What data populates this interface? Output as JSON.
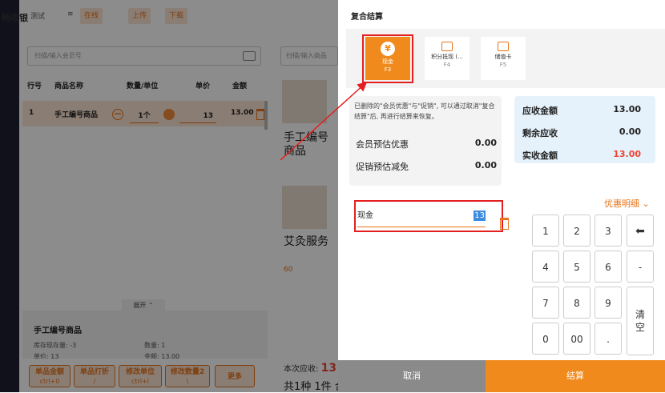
{
  "topbar": {
    "brand": "畅收银",
    "store": "测试",
    "status": "在线",
    "upload": "上传",
    "download": "下载"
  },
  "member_search": {
    "placeholder": "扫描/输入会员号"
  },
  "table": {
    "headers": [
      "行号",
      "商品名称",
      "数量/单位",
      "单价",
      "金额"
    ],
    "row": {
      "index": "1",
      "name": "手工编号商品",
      "qty": "1个",
      "price": "13",
      "amount": "13.00"
    }
  },
  "panel": {
    "expand": "展开",
    "title": "手工编号商品",
    "stock_label": "库存现存量: -3",
    "qty_label": "数量: 1",
    "price_label": "单价: 13",
    "amount_label": "金额: 13.00"
  },
  "buttons": [
    {
      "label": "单品金额",
      "shortcut": "ctrl+0"
    },
    {
      "label": "单品打折",
      "shortcut": "/"
    },
    {
      "label": "修改单位",
      "shortcut": "ctrl+l"
    },
    {
      "label": "修改数量2",
      "shortcut": "\\"
    },
    {
      "label": "更多",
      "shortcut": ""
    }
  ],
  "products": {
    "search_placeholder": "扫描/输入商品",
    "items": [
      {
        "name": "手工编号商品",
        "price": ""
      },
      {
        "name": "艾灸服务",
        "price": "60"
      }
    ]
  },
  "summary": {
    "due_label": "本次应收:",
    "due_value": "13",
    "count": "共1种 1件 合"
  },
  "modal": {
    "title": "复合结算",
    "tabs": [
      {
        "label": "现金",
        "key": "F3",
        "icon": "¥"
      },
      {
        "label": "积分抵现 (...",
        "key": "F4"
      },
      {
        "label": "储值卡",
        "key": "F5"
      }
    ],
    "note": "已删除的\"会员优惠\"与\"促销\", 可以通过取消\"复合结算\"后, 再进行结算来恢复。",
    "member_discount": {
      "label": "会员预估优惠",
      "value": "0.00"
    },
    "promo_discount": {
      "label": "促销预估减免",
      "value": "0.00"
    },
    "receivable": {
      "label": "应收金额",
      "value": "13.00"
    },
    "remaining": {
      "label": "剩余应收",
      "value": "0.00"
    },
    "actual": {
      "label": "实收金额",
      "value": "13.00"
    },
    "detail_link": "优惠明细",
    "pay_method": "现金",
    "pay_amount": "13",
    "keypad": [
      "1",
      "2",
      "3",
      "4",
      "5",
      "6",
      "7",
      "8",
      "9",
      "0",
      "00",
      "."
    ],
    "minus": "-",
    "clear": "清\n空",
    "cancel": "取消",
    "confirm": "结算"
  },
  "colors": {
    "accent": "#f08a1c",
    "highlight": "#e31f1f",
    "info_bg": "#e6f2fb"
  }
}
